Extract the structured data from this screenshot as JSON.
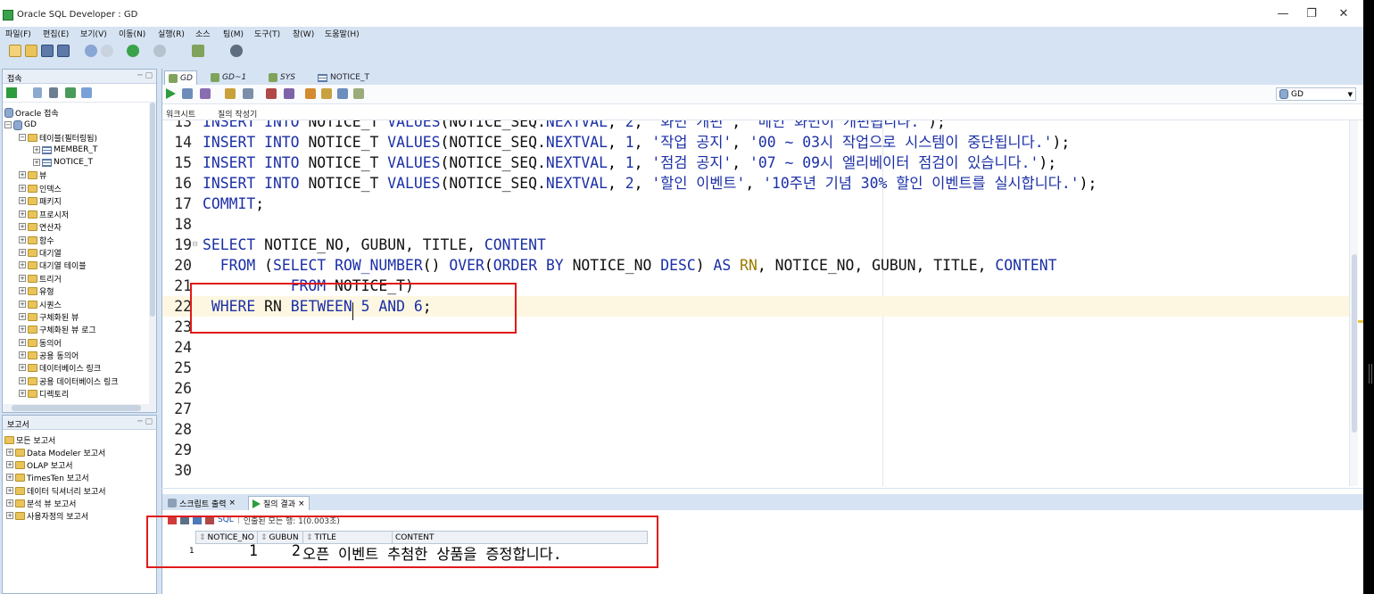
{
  "window": {
    "title": "Oracle SQL Developer : GD",
    "minimize": "—",
    "restore": "❐",
    "close": "✕"
  },
  "menu": [
    "파일(F)",
    "편집(E)",
    "보기(V)",
    "이동(N)",
    "실행(R)",
    "소스",
    "팀(M)",
    "도구(T)",
    "창(W)",
    "도움말(H)"
  ],
  "connections_pane": {
    "title": "접속",
    "tree": [
      {
        "label": "Oracle 접속",
        "icon": "db-folder-icon"
      },
      {
        "label": "GD",
        "icon": "db-icon"
      },
      {
        "label": "테이블(필터링됨)",
        "icon": "folder-icon"
      },
      {
        "label": "MEMBER_T",
        "icon": "table-icon"
      },
      {
        "label": "NOTICE_T",
        "icon": "table-icon"
      },
      {
        "label": "뷰",
        "icon": "folder-icon"
      },
      {
        "label": "인덱스",
        "icon": "folder-icon"
      },
      {
        "label": "패키지",
        "icon": "folder-icon"
      },
      {
        "label": "프로시저",
        "icon": "folder-icon"
      },
      {
        "label": "연산자",
        "icon": "folder-icon"
      },
      {
        "label": "함수",
        "icon": "folder-icon"
      },
      {
        "label": "대기열",
        "icon": "folder-icon"
      },
      {
        "label": "대기열 테이블",
        "icon": "folder-icon"
      },
      {
        "label": "트리거",
        "icon": "folder-icon"
      },
      {
        "label": "유형",
        "icon": "folder-icon"
      },
      {
        "label": "시퀀스",
        "icon": "folder-icon"
      },
      {
        "label": "구체화된 뷰",
        "icon": "folder-icon"
      },
      {
        "label": "구체화된 뷰 로그",
        "icon": "folder-icon"
      },
      {
        "label": "동의어",
        "icon": "folder-icon"
      },
      {
        "label": "공용 동의어",
        "icon": "folder-icon"
      },
      {
        "label": "데이터베이스 링크",
        "icon": "folder-icon"
      },
      {
        "label": "공용 데이터베이스 링크",
        "icon": "folder-icon"
      },
      {
        "label": "디렉토리",
        "icon": "folder-icon"
      }
    ]
  },
  "reports_pane": {
    "title": "보고서",
    "items": [
      "모든 보고서",
      "Data Modeler 보고서",
      "OLAP 보고서",
      "TimesTen 보고서",
      "데이터 딕셔너리 보고서",
      "분석 뷰 보고서",
      "사용자정의 보고서"
    ]
  },
  "doc_tabs": [
    {
      "label": "GD",
      "active": true
    },
    {
      "label": "GD~1",
      "active": false
    },
    {
      "label": "SYS",
      "active": false
    },
    {
      "label": "NOTICE_T",
      "active": false
    }
  ],
  "connection_selector": "GD",
  "sub_tabs": [
    "워크시트",
    "질의 작성기"
  ],
  "code_lines": [
    {
      "n": "13",
      "html": "<span class='kw'>INSERT INTO</span> <span class='pl'>NOTICE_T</span> <span class='kw'>VALUES</span>(<span class='pl'>NOTICE_SEQ</span>.<span class='kw'>NEXTVAL</span>, <span class='num'>2</span>, <span class='str'>'화면 개편'</span>, <span class='str'>'메인 화면이 개편됩니다.'</span>);"
    },
    {
      "n": "14",
      "html": "<span class='kw'>INSERT INTO</span> <span class='pl'>NOTICE_T</span> <span class='kw'>VALUES</span>(<span class='pl'>NOTICE_SEQ</span>.<span class='kw'>NEXTVAL</span>, <span class='num'>1</span>, <span class='str'>'작업 공지'</span>, <span class='str'>'00 ~ 03시 작업으로 시스템이 중단됩니다.'</span>);"
    },
    {
      "n": "15",
      "html": "<span class='kw'>INSERT INTO</span> <span class='pl'>NOTICE_T</span> <span class='kw'>VALUES</span>(<span class='pl'>NOTICE_SEQ</span>.<span class='kw'>NEXTVAL</span>, <span class='num'>1</span>, <span class='str'>'점검 공지'</span>, <span class='str'>'07 ~ 09시 엘리베이터 점검이 있습니다.'</span>);"
    },
    {
      "n": "16",
      "html": "<span class='kw'>INSERT INTO</span> <span class='pl'>NOTICE_T</span> <span class='kw'>VALUES</span>(<span class='pl'>NOTICE_SEQ</span>.<span class='kw'>NEXTVAL</span>, <span class='num'>2</span>, <span class='str'>'할인 이벤트'</span>, <span class='str'>'10주년 기념 30% 할인 이벤트를 실시합니다.'</span>);"
    },
    {
      "n": "17",
      "html": "<span class='kw'>COMMIT</span>;"
    },
    {
      "n": "18",
      "html": ""
    },
    {
      "n": "19",
      "html": "<span class='kw'>SELECT</span> <span class='pl'>NOTICE_NO</span>, <span class='pl'>GUBUN</span>, <span class='pl'>TITLE</span>, <span class='kw'>CONTENT</span>",
      "fold": "⊟"
    },
    {
      "n": "20",
      "html": "  <span class='kw'>FROM</span> (<span class='kw'>SELECT</span> <span class='kw'>ROW_NUMBER</span>() <span class='kw'>OVER</span>(<span class='kw'>ORDER BY</span> <span class='pl'>NOTICE_NO</span> <span class='kw'>DESC</span>) <span class='kw'>AS</span> <span class='ol'>RN</span>, <span class='pl'>NOTICE_NO</span>, <span class='pl'>GUBUN</span>, <span class='pl'>TITLE</span>, <span class='kw'>CONTENT</span>"
    },
    {
      "n": "21",
      "html": "          <span class='kw'>FROM</span> <span class='pl'>NOTICE_T</span>)"
    },
    {
      "n": "22",
      "html": " <span class='kw'>WHERE</span> <span class='pl'>RN</span> <span class='kw'>BETWEEN</span> <span class='num'>5</span> <span class='kw'>AND</span> <span class='num'>6</span>;",
      "current": true
    },
    {
      "n": "23",
      "html": ""
    },
    {
      "n": "24",
      "html": ""
    },
    {
      "n": "25",
      "html": ""
    },
    {
      "n": "26",
      "html": ""
    },
    {
      "n": "27",
      "html": ""
    },
    {
      "n": "28",
      "html": ""
    },
    {
      "n": "29",
      "html": ""
    },
    {
      "n": "30",
      "html": ""
    }
  ],
  "output_tabs": [
    {
      "label": "스크립트 출력",
      "close": "×",
      "active": false
    },
    {
      "label": "질의 결과",
      "close": "×",
      "active": true
    }
  ],
  "output_toolbar": {
    "sql_label": "SQL",
    "status": "인출된 모든 행: 1(0.003초)"
  },
  "result_grid": {
    "columns": [
      "NOTICE_NO",
      "GUBUN",
      "TITLE",
      "CONTENT"
    ],
    "rows": [
      {
        "row": "1",
        "notice_no": "1",
        "gubun": "2",
        "title": "오픈 이벤트 추첨한 상품을 증정합니다."
      }
    ]
  },
  "colors": {
    "keyword": "#1b2fa6",
    "annotation_box": "#e01a1a",
    "window_bg": "#d6e3f2"
  }
}
